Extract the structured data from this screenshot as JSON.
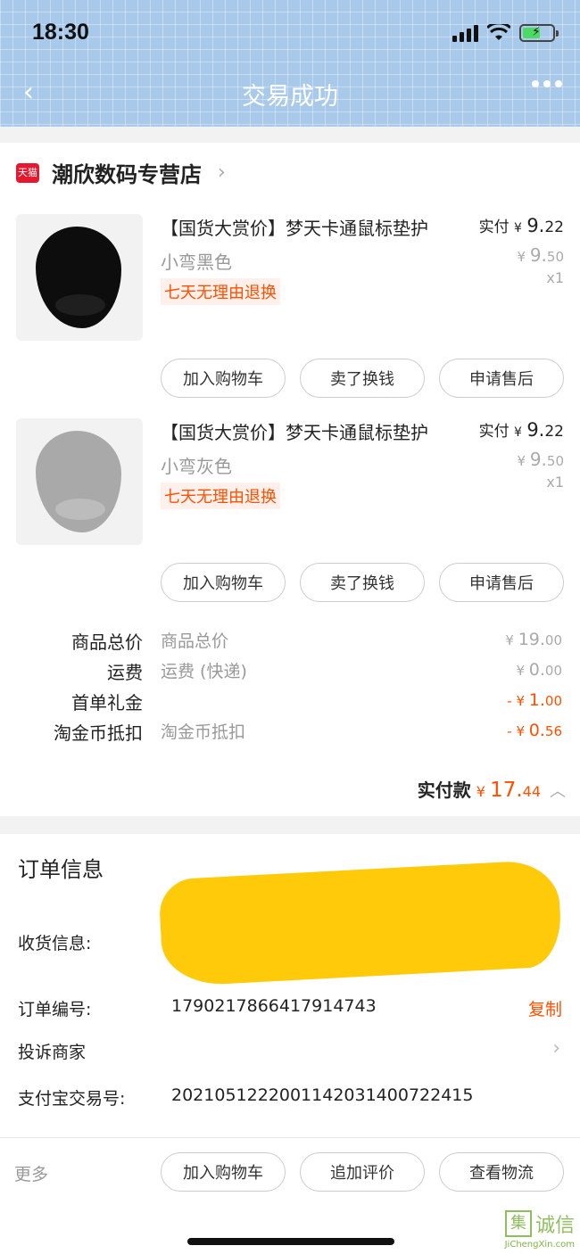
{
  "status_bar": {
    "time": "18:30"
  },
  "nav": {
    "back": "‹",
    "title": "交易成功"
  },
  "store": {
    "badge": "天猫",
    "name": "潮欣数码专营店",
    "chevron": "›"
  },
  "products": [
    {
      "title": "【国货大赏价】梦天卡通鼠标垫护",
      "variant": "小弯黑色",
      "tag": "七天无理由退换",
      "paid_label": "实付",
      "paid_yen": "¥",
      "paid_int": "9.",
      "paid_dec": "22",
      "orig_yen": "¥",
      "orig_int": "9.",
      "orig_dec": "50",
      "qty": "x1",
      "color": "black"
    },
    {
      "title": "【国货大赏价】梦天卡通鼠标垫护",
      "variant": "小弯灰色",
      "tag": "七天无理由退换",
      "paid_label": "实付",
      "paid_yen": "¥",
      "paid_int": "9.",
      "paid_dec": "22",
      "orig_yen": "¥",
      "orig_int": "9.",
      "orig_dec": "50",
      "qty": "x1",
      "color": "gray"
    }
  ],
  "item_buttons": {
    "add_cart": "加入购物车",
    "resell": "卖了换钱",
    "after_sale": "申请售后"
  },
  "summary": [
    {
      "label": "商品总价",
      "desc": "商品总价",
      "prefix": "¥ ",
      "int": "19.",
      "dec": "00",
      "orange": false
    },
    {
      "label": "运费",
      "desc": "运费 (快递)",
      "prefix": "¥ ",
      "int": "0.",
      "dec": "00",
      "orange": false
    },
    {
      "label": "首单礼金",
      "desc": "",
      "prefix": "- ¥ ",
      "int": "1.",
      "dec": "00",
      "orange": true
    },
    {
      "label": "淘金币抵扣",
      "desc": "淘金币抵扣",
      "prefix": "- ¥ ",
      "int": "0.",
      "dec": "56",
      "orange": true
    }
  ],
  "total": {
    "label": "实付款",
    "prefix": "¥ ",
    "int": "17.",
    "dec": "44"
  },
  "order_info": {
    "heading": "订单信息",
    "shipping_label": "收货信息:",
    "order_no_label": "订单编号:",
    "order_no": "1790217866417914743",
    "copy": "复制",
    "complain": "投诉商家",
    "alipay_label": "支付宝交易号:",
    "alipay_no": "2021051222001142031400722415"
  },
  "bottom_bar": {
    "more": "更多",
    "add_cart": "加入购物车",
    "add_review": "追加评价",
    "logistics": "查看物流"
  },
  "watermark": {
    "box": "集",
    "text": "诚信",
    "sub": "JiChengXin.com"
  },
  "colors": {
    "accent": "#ff5000",
    "header_bg": "#a9c9ea",
    "tmall_red": "#e4182f"
  }
}
